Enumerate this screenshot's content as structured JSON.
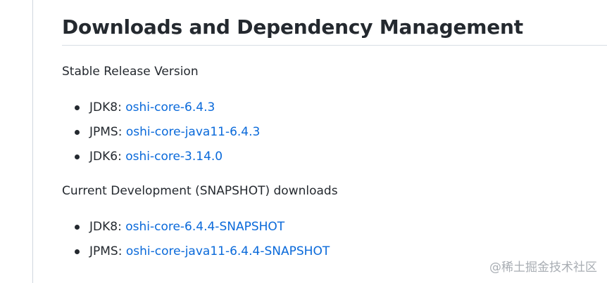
{
  "heading": "Downloads and Dependency Management",
  "stable": {
    "label": "Stable Release Version",
    "items": [
      {
        "prefix": "JDK8: ",
        "link": "oshi-core-6.4.3"
      },
      {
        "prefix": "JPMS: ",
        "link": "oshi-core-java11-6.4.3"
      },
      {
        "prefix": "JDK6: ",
        "link": "oshi-core-3.14.0"
      }
    ]
  },
  "snapshot": {
    "label": "Current Development (SNAPSHOT) downloads",
    "items": [
      {
        "prefix": "JDK8: ",
        "link": "oshi-core-6.4.4-SNAPSHOT"
      },
      {
        "prefix": "JPMS: ",
        "link": "oshi-core-java11-6.4.4-SNAPSHOT"
      }
    ]
  },
  "watermark": "@稀土掘金技术社区",
  "colors": {
    "link": "#0969da",
    "text": "#24292f"
  }
}
